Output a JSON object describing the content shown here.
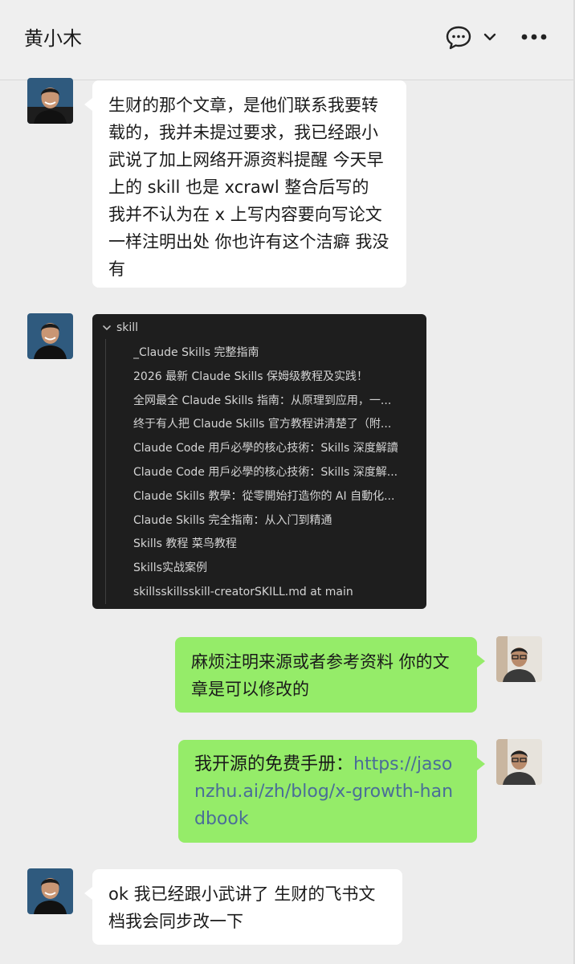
{
  "header": {
    "title": "黄小木"
  },
  "messages": {
    "m1": "生财的那个文章，是他们联系我要转载的，我并未提过要求，我已经跟小武说了加上网络开源资料提醒 今天早上的 skill 也是 xcrawl 整合后写的 我并不认为在 x 上写内容要向写论文一样注明出处 你也许有这个洁癖 我没有",
    "m3": "麻烦注明来源或者参考资料 你的文章是可以修改的",
    "m4_prefix": "我开源的免费手册：",
    "m4_link": "https://jasonzhu.ai/zh/blog/x-growth-handbook",
    "m5": "ok 我已经跟小武讲了 生财的飞书文档我会同步改一下"
  },
  "folder": {
    "name": "skill",
    "items": [
      "_Claude Skills 完整指南",
      "2026 最新 Claude Skills 保姆级教程及实践！",
      "全网最全 Claude Skills 指南：从原理到应用，一...",
      "终于有人把 Claude Skills 官方教程讲清楚了（附...",
      "Claude Code 用戶必學的核心技術：Skills 深度解讀",
      "Claude Code 用戶必學的核心技術：Skills 深度解...",
      "Claude Skills 教學：從零開始打造你的 AI 自動化...",
      "Claude Skills 完全指南：从入门到精通",
      "Skills 教程  菜鸟教程",
      "Skills实战案例",
      "skillsskillsskill-creatorSKILL.md at main"
    ]
  },
  "icons": {
    "chat": "chat-bubble-icon",
    "dropdown": "chevron-down-icon",
    "more": "more-dots-icon",
    "folder_toggle": "chevron-down-icon"
  },
  "colors": {
    "self_bubble": "#95ec69",
    "other_bubble": "#ffffff",
    "link": "#4a6d98",
    "background": "#ededed"
  }
}
